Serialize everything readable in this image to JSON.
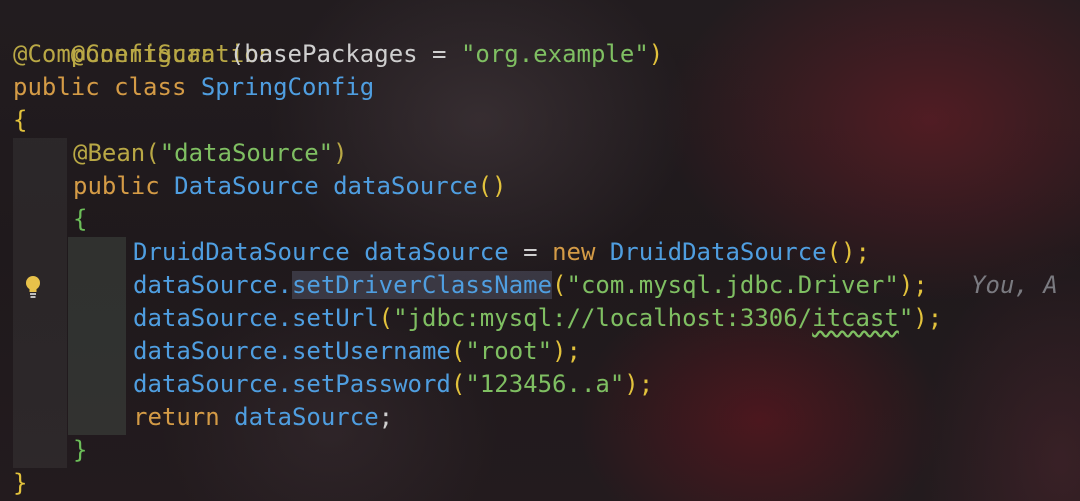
{
  "editor": {
    "lines": {
      "l1": {
        "t": "@Configuration"
      },
      "l2": {
        "t1": "@ComponentScan",
        "t2": " (basePackages = ",
        "t3": "\"org.example\"",
        "t4": ")"
      },
      "l3": {
        "t1": "public class ",
        "t2": "SpringConfig"
      },
      "l4": {
        "t": "{"
      },
      "l5": {
        "t1": "@Bean(",
        "t2": "\"dataSource\"",
        "t3": ")"
      },
      "l6": {
        "t1": "public ",
        "t2": "DataSource",
        "t3": " ",
        "t4": "dataSource",
        "t5": "()"
      },
      "l7": {
        "t": "{"
      },
      "l8": {
        "t1": "DruidDataSource",
        "t2": " dataSource",
        "t3": " = ",
        "t4": "new ",
        "t5": "DruidDataSource",
        "t6": "();"
      },
      "l9": {
        "t1": "dataSource.",
        "t2": "setDriverClassName",
        "t3": "(",
        "t4": "\"com.mysql.jdbc.Driver\"",
        "t5": ");",
        "t6": "   You, A"
      },
      "l10": {
        "t1": "dataSource.setUrl",
        "t2": "(",
        "t3": "\"jdbc:mysql://localhost:3306/",
        "t4": "itcast",
        "t5": "\"",
        "t6": ");"
      },
      "l11": {
        "t1": "dataSource.setUsername",
        "t2": "(",
        "t3": "\"root\"",
        "t4": ");"
      },
      "l12": {
        "t1": "dataSource.setPassword",
        "t2": "(",
        "t3": "\"123456..a\"",
        "t4": ");"
      },
      "l13": {
        "t1": "return ",
        "t2": "dataSource",
        "t3": ";"
      },
      "l14": {
        "t": "}"
      },
      "l15": {
        "t": "}"
      }
    },
    "gutter_icon": "lightbulb-icon",
    "colors": {
      "annotation": "#b9a845",
      "keyword": "#d49b46",
      "type": "#4f9ee0",
      "string": "#7fbf62",
      "brace": "#e2c23c"
    }
  }
}
